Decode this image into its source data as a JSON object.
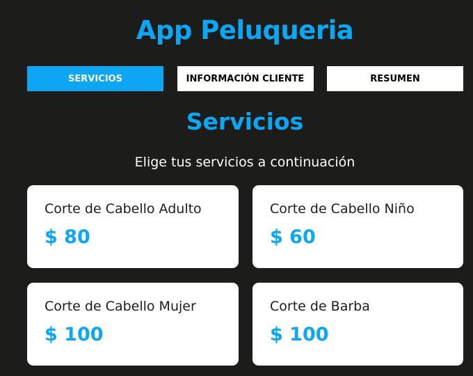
{
  "app": {
    "title": "App Peluqueria"
  },
  "tabs": [
    {
      "label": "SERVICIOS",
      "active": true
    },
    {
      "label": "INFORMACIÓN CLIENTE",
      "active": false
    },
    {
      "label": "RESUMEN",
      "active": false
    }
  ],
  "section": {
    "title": "Servicios",
    "subtitle": "Elige tus servicios a continuación"
  },
  "services": [
    {
      "name": "Corte de Cabello Adulto",
      "price": "$ 80"
    },
    {
      "name": "Corte de Cabello Niño",
      "price": "$ 60"
    },
    {
      "name": "Corte de Cabello Mujer",
      "price": "$ 100"
    },
    {
      "name": "Corte de Barba",
      "price": "$ 100"
    }
  ],
  "colors": {
    "accent": "#0da6f3",
    "background": "#1c1c1b",
    "card": "#ffffff"
  }
}
